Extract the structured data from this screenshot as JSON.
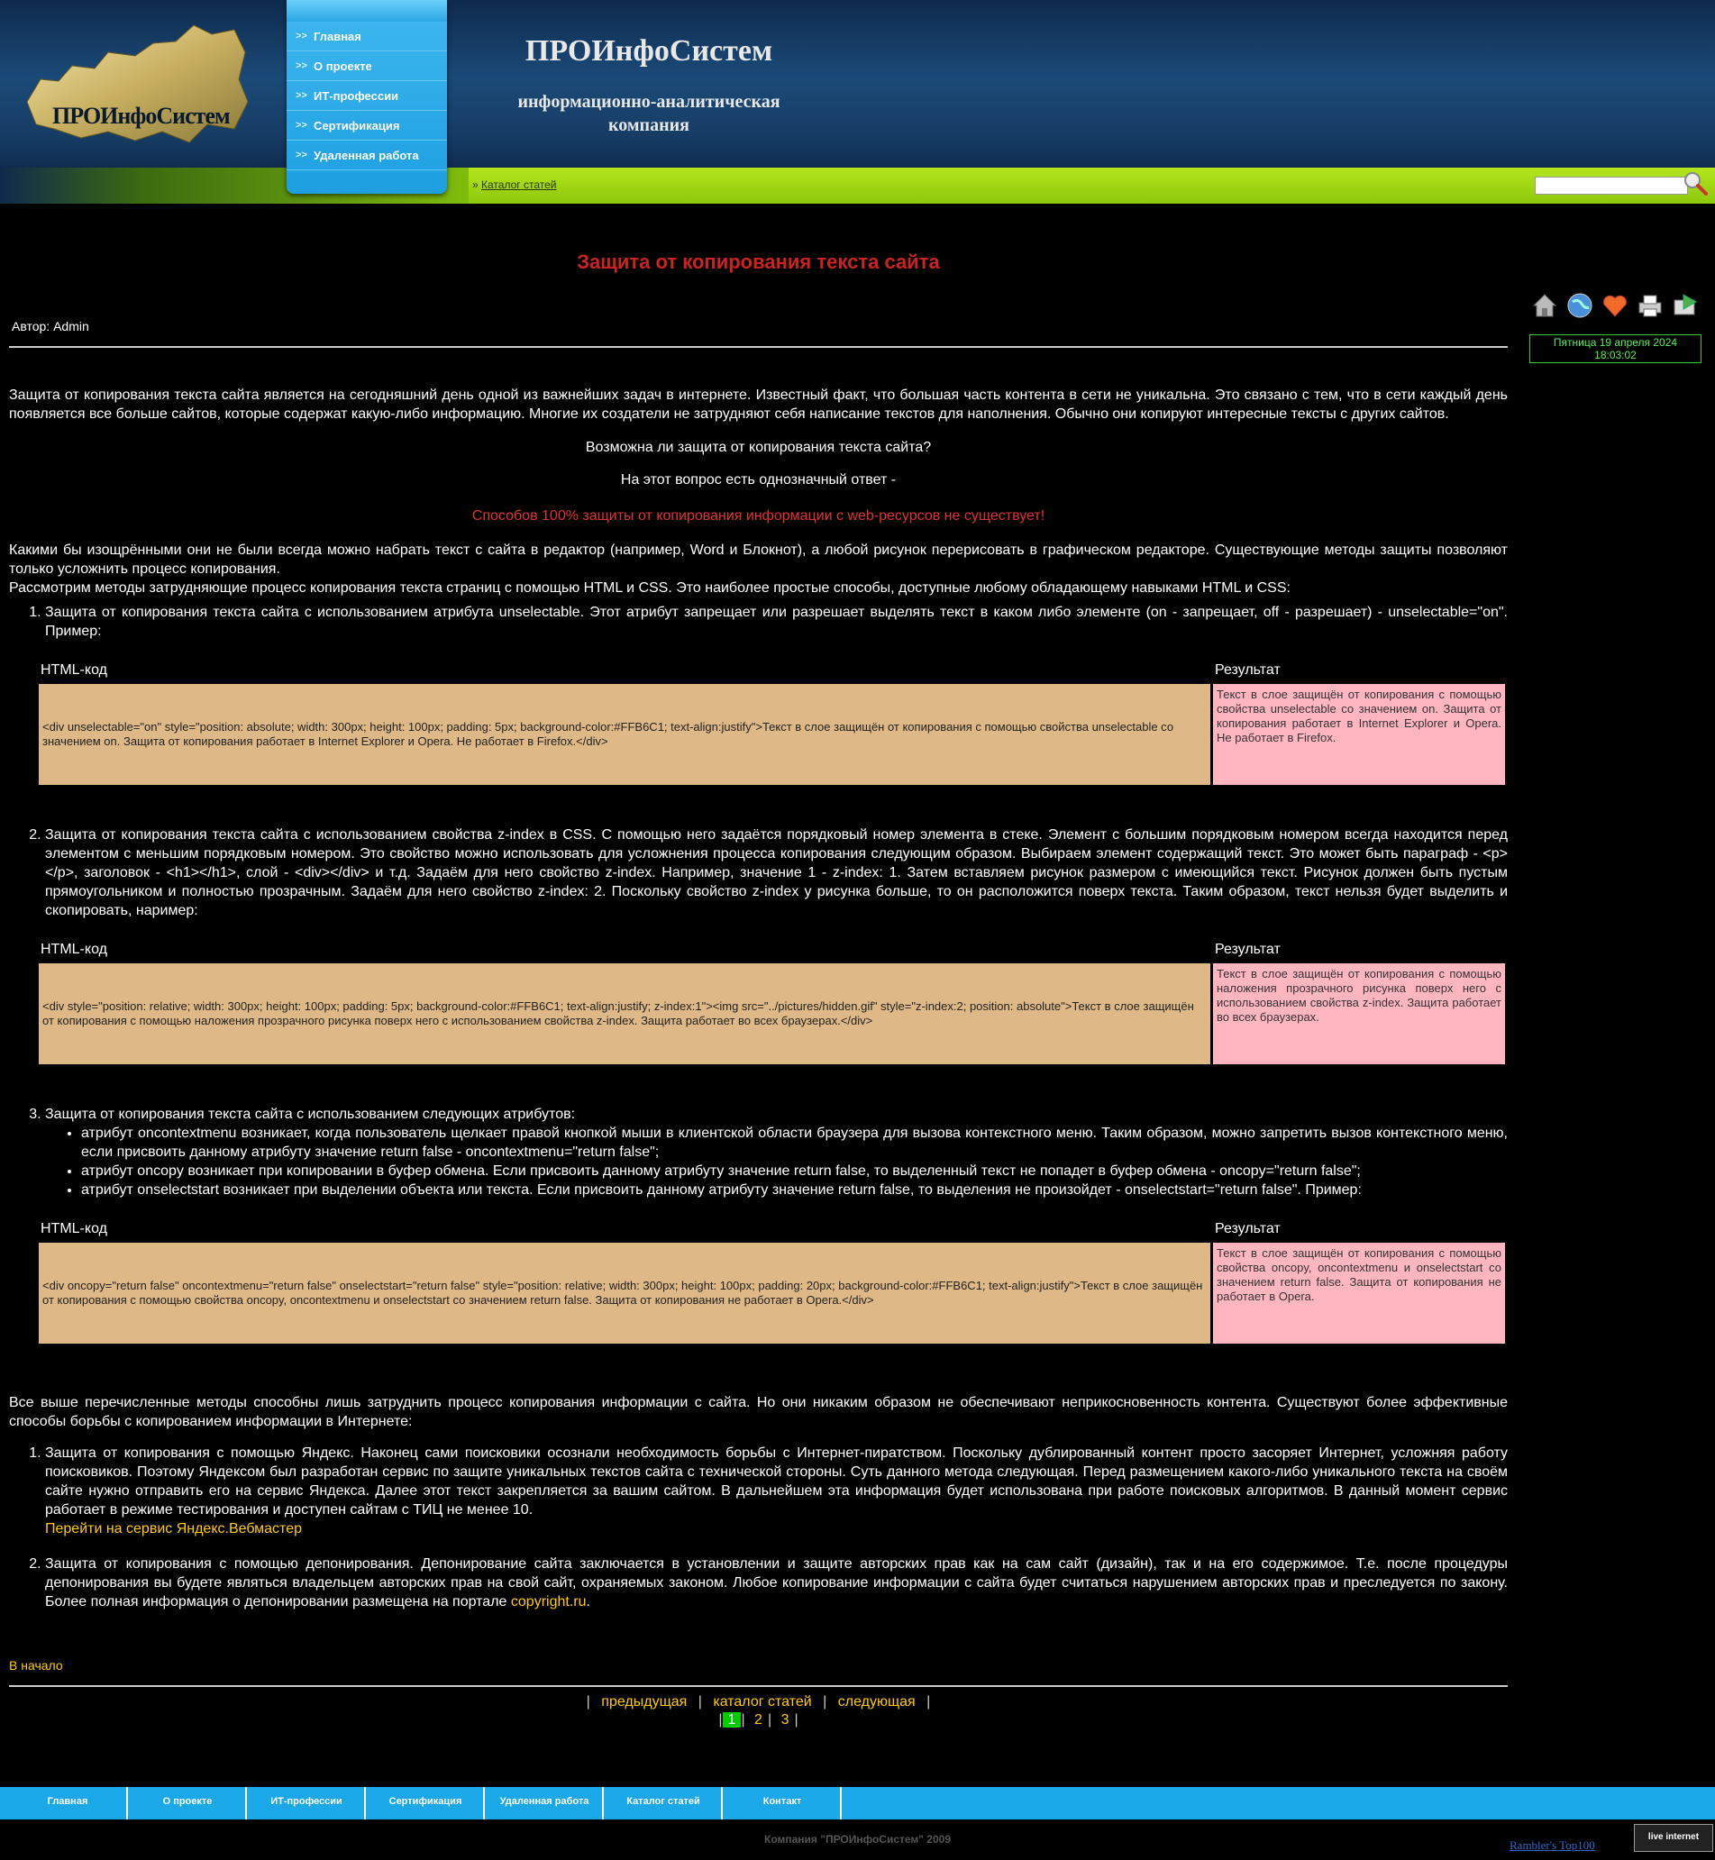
{
  "header": {
    "logo_text": "ПРОИнфоСистем",
    "brand_title": "ПРОИнфоСистем",
    "brand_subtitle": "информационно-аналитическая компания",
    "menu": [
      "Главная",
      "О проекте",
      "ИТ-профессии",
      "Сертификация",
      "Удаленная работа"
    ],
    "breadcrumb": "Каталог статей",
    "search_value": ""
  },
  "article": {
    "title": "Защита от копирования текста сайта",
    "author": "Автор: Admin",
    "intro": "Защита от копирования текста сайта является на сегодняшний день одной из важнейших задач в интернете. Известный факт, что большая часть контента в сети не уникальна. Это связано с тем, что в сети каждый день появляется все больше сайтов, которые содержат какую-либо информацию. Многие их создатели не затрудняют себя написание текстов для наполнения. Обычно они копируют интересные тексты с других сайтов.",
    "question": "Возможна ли защита от копирования текста сайта?",
    "answer_lead": "На этот вопрос есть однозначный ответ -",
    "answer": "Способов 100% защиты от копирования информации с web-ресурсов не существует!",
    "para2": "Какими бы изощрёнными они не были всегда можно набрать текст с сайта в редактор (например, Word и Блокнот), а любой рисунок перерисовать в графическом редакторе. Существующие методы защиты позволяют только усложнить процесс копирования.",
    "para3": "Рассмотрим методы затрудняющие процесс копирования текста страниц с помощью HTML и CSS. Это наиболее простые способы, доступные любому обладающему навыками HTML и CSS:",
    "col_code": "HTML-код",
    "col_result": "Результат",
    "methods": [
      {
        "text": "Защита от копирования текста сайта с использованием атрибута unselectable. Этот атрибут запрещает или разрешает выделять текст в каком либо элементе (on - запрещает, off - разрешает) - unselectable=\"on\". Пример:",
        "code": "<div unselectable=\"on\" style=\"position: absolute; width: 300px; height: 100px; padding: 5px; background-color:#FFB6C1; text-align:justify\">Текст в слое защищён от копирования с помощью свойства unselectable со значением on. Защита от копирования работает в Internet Explorer и Opera. Не работает в Firefox.</div>",
        "result": "Текст в слое защищён от копирования с помощью свойства unselectable со значением on. Защита от копирования работает в Internet Explorer и Opera. Не работает в Firefox."
      },
      {
        "text": "Защита от копирования текста сайта с использованием свойства z-index в CSS. С помощью него задаётся порядковый номер элемента в стеке. Элемент с большим порядковым номером всегда находится перед элементом с меньшим порядковым номером. Это свойство можно использовать для усложнения процесса копирования следующим образом. Выбираем элемент содержащий текст. Это может быть параграф - <p></p>, заголовок - <h1></h1>, слой - <div></div> и т.д. Задаём для него свойство z-index. Например, значение 1 - z-index: 1. Затем вставляем рисунок размером с имеющийся текст. Рисунок должен быть пустым прямоугольником и полностью прозрачным. Задаём для него свойство z-index: 2. Поскольку свойство z-index у рисунка больше, то он расположится поверх текста. Таким образом, текст нельзя будет выделить и скопировать, наример:",
        "code": "<div style=\"position: relative; width: 300px; height: 100px; padding: 5px; background-color:#FFB6C1; text-align:justify; z-index:1\"><img src=\"../pictures/hidden.gif\" style=\"z-index:2; position: absolute\">Текст в слое защищён от копирования с помощью наложения прозрачного рисунка поверх него с использованием свойства z-index. Защита работает во всех браузерах.</div>",
        "result": "Текст в слое защищён от копирования с помощью наложения прозрачного рисунка поверх него с использованием свойства z-index. Защита работает во всех браузерах."
      },
      {
        "text": "Защита от копирования текста сайта с использованием следующих атрибутов:",
        "bullets": [
          "атрибут oncontextmenu возникает, когда пользователь щелкает правой кнопкой мыши в клиентской области браузера для вызова контекстного меню. Таким образом, можно запретить вызов контекстного меню, если присвоить данному атрибуту значение return false - oncontextmenu=\"return false\";",
          "атрибут oncopy возникает при копировании в буфер обмена. Если присвоить данному атрибуту значение return false, то выделенный текст не попадет в буфер обмена - oncopy=\"return false\";",
          "атрибут onselectstart возникает при выделении объекта или текста. Если присвоить данному атрибуту значение return false, то выделения не произойдет - onselectstart=\"return false\". Пример:"
        ],
        "code": "<div oncopy=\"return false\" oncontextmenu=\"return false\" onselectstart=\"return false\" style=\"position: relative; width: 300px; height: 100px; padding: 20px; background-color:#FFB6C1; text-align:justify\">Текст в слое защищён от копирования с помощью свойства oncopy, oncontextmenu и onselectstart со значением return false. Защита от копирования не работает в Opera.</div>",
        "result": "Текст в слое защищён от копирования с помощью свойства oncopy, oncontextmenu и onselectstart со значением return false. Защита от копирования не работает в Opera."
      }
    ],
    "para4": "Все выше перечисленные методы способны лишь затруднить процесс копирования информации с сайта. Но они никаким образом не обеспечивают неприкосновенность контента. Существуют более эффективные способы борьбы с копированием информации в Интернете:",
    "effective": [
      {
        "text": "Защита от копирования с помощью Яндекс. Наконец сами поисковики осознали необходимость борьбы с Интернет-пиратством. Поскольку дублированный контент просто засоряет Интернет, усложняя работу поисковиков. Поэтому Яндексом был разработан сервис по защите уникальных текстов сайта с технической стороны. Суть данного метода следующая. Перед размещением какого-либо уникального текста на своём сайте нужно отправить его на сервис Яндекса. Далее этот текст закрепляется за вашим сайтом. В дальнейшем эта информация будет использована при работе поисковых алгоритмов. В данный момент сервис работает в режиме тестирования и доступен сайтам с ТИЦ не менее 10.",
        "link": "Перейти на сервис Яндекс.Вебмастер"
      },
      {
        "text": "Защита от копирования с помощью депонирования. Депонирование сайта заключается в установлении и защите авторских прав как на сам сайт (дизайн), так и на его содержимое. Т.е. после процедуры депонирования вы будете являться владельцем авторских прав на свой сайт, охраняемых законом. Любое копирование информации с сайта будет считаться нарушением авторских прав и преследуется по закону. Более полная информация о депонировании размещена на портале",
        "link": "copyright.ru",
        "tail": "."
      }
    ],
    "to_top": "В начало",
    "nav": {
      "prev": "предыдущая",
      "catalog": "каталог статей",
      "next": "следующая"
    },
    "pages": [
      "1",
      "2",
      "3"
    ]
  },
  "sidebar": {
    "icons": [
      "home-icon",
      "globe-icon",
      "favorites-icon",
      "print-icon",
      "send-icon"
    ],
    "date": "Пятница 19 апреля 2024",
    "time": "18:03:02"
  },
  "footer": {
    "menu": [
      "Главная",
      "О проекте",
      "ИТ-профессии",
      "Сертификация",
      "Удаленная работа",
      "Каталог статей",
      "Контакт"
    ],
    "copyright": "Компания \"ПРОИнфоСистем\"   2009",
    "rambler": "Rambler's Top100",
    "counter": "live internet"
  },
  "colors": {
    "title_red": "#cc2222",
    "link_yellow": "#ffcc00",
    "code_bg": "#deb887",
    "result_bg": "#ffb6c1",
    "menu_blue": "#1aa8e8"
  }
}
